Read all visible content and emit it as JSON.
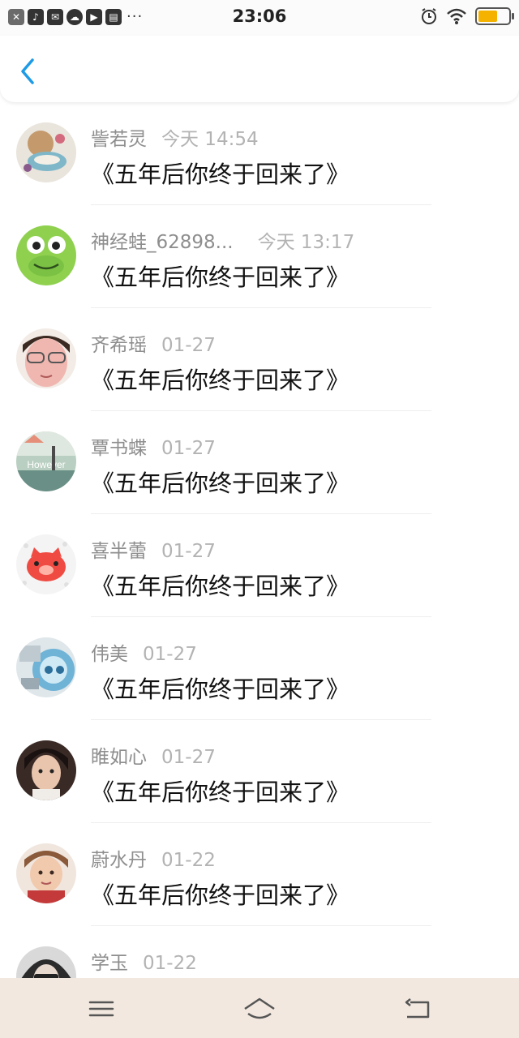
{
  "status_bar": {
    "time": "23:06",
    "left_icons": [
      "close-box-icon",
      "tiktok-icon",
      "mail-icon",
      "cloud-icon",
      "play-icon",
      "image-icon"
    ],
    "overflow": "···",
    "battery_level": 0.65,
    "battery_color": "#f5b300"
  },
  "header": {
    "back_icon": "chevron-left-icon",
    "accent": "#1e9be6"
  },
  "comments": [
    {
      "name": "訾若灵",
      "time": "今天 14:54",
      "message": "《五年后你终于回来了》"
    },
    {
      "name": "神经蛙_62898...",
      "time": "今天 13:17",
      "message": "《五年后你终于回来了》"
    },
    {
      "name": "齐希瑶",
      "time": "01-27",
      "message": "《五年后你终于回来了》"
    },
    {
      "name": "覃书蝶",
      "time": "01-27",
      "message": "《五年后你终于回来了》"
    },
    {
      "name": "喜半蕾",
      "time": "01-27",
      "message": "《五年后你终于回来了》"
    },
    {
      "name": "伟美",
      "time": "01-27",
      "message": "《五年后你终于回来了》"
    },
    {
      "name": "睢如心",
      "time": "01-27",
      "message": "《五年后你终于回来了》"
    },
    {
      "name": "蔚水丹",
      "time": "01-22",
      "message": "《五年后你终于回来了》"
    },
    {
      "name": "学玉",
      "time": "01-22",
      "message": ""
    }
  ],
  "avatar_texts": {
    "however": "However"
  },
  "nav_bar": {
    "icons": [
      "menu-icon",
      "home-icon",
      "back-icon"
    ],
    "background": "#f2e8df"
  }
}
